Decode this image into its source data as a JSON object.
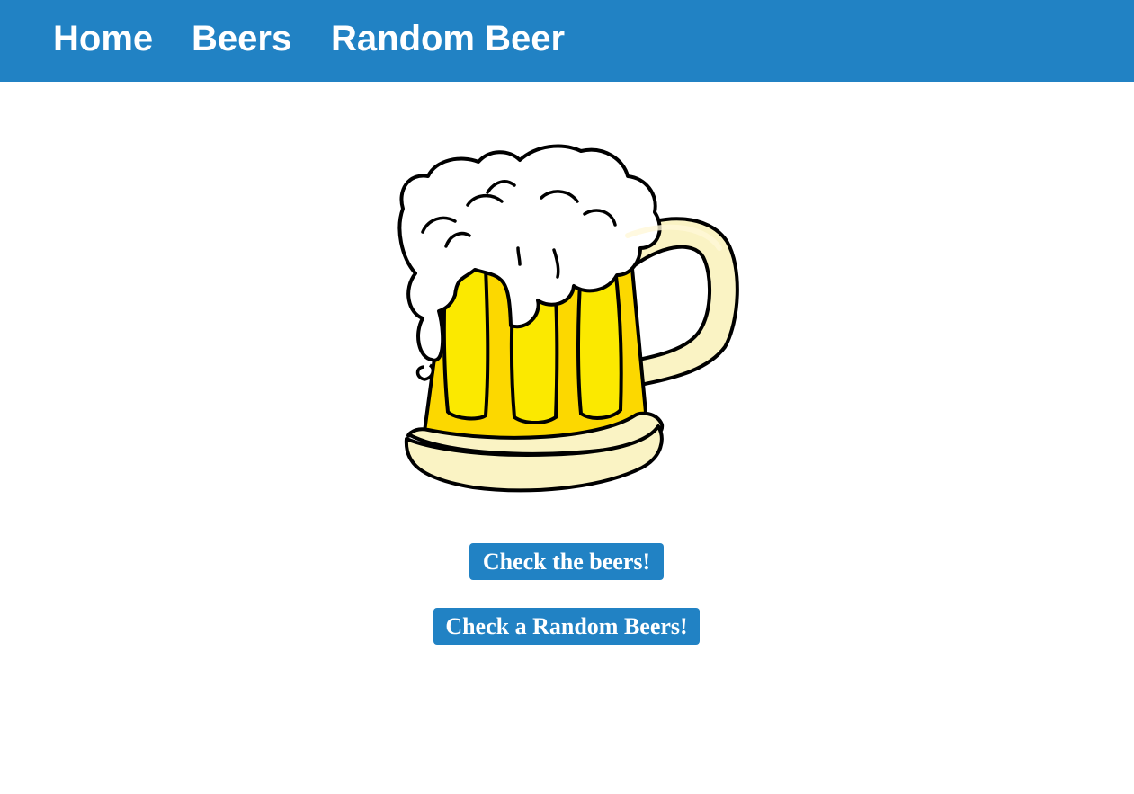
{
  "nav": {
    "items": [
      {
        "label": "Home"
      },
      {
        "label": "Beers"
      },
      {
        "label": "Random Beer"
      }
    ]
  },
  "main": {
    "image": {
      "icon": "beer-mug-icon"
    },
    "buttons": {
      "check_beers": "Check the beers!",
      "check_random": "Check a Random Beers!"
    }
  },
  "colors": {
    "brand": "#2182c4",
    "button_text": "#ffffff",
    "beer": "#fcd800",
    "foam": "#ffffff",
    "glass": "#faf3c4"
  }
}
